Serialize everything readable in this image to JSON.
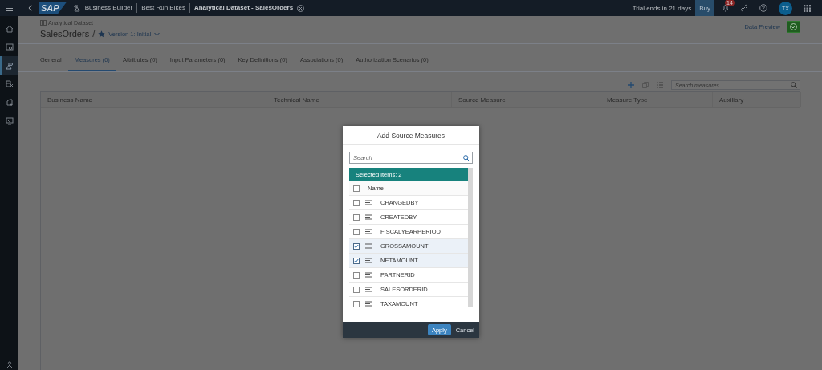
{
  "top_bar": {
    "logo": "SAP",
    "breadcrumbs": [
      "Business Builder",
      "Best Run Bikes",
      "Analytical Dataset - SalesOrders"
    ],
    "trial_text": "Trial ends in 21 days",
    "buy_button": "Buy",
    "notification_count": "14",
    "avatar": "TX"
  },
  "sidebar": {
    "items": [
      {
        "selected": false
      },
      {
        "selected": false
      },
      {
        "selected": true
      },
      {
        "selected": false
      },
      {
        "selected": false
      },
      {
        "selected": false
      }
    ]
  },
  "header": {
    "object_type": "Analytical Dataset",
    "title": "SalesOrders",
    "separator": "/",
    "version": "Version 1: Initial",
    "data_preview": "Data Preview"
  },
  "tabs": [
    {
      "label": "General",
      "selected": false
    },
    {
      "label": "Measures (0)",
      "selected": true
    },
    {
      "label": "Attributes (0)",
      "selected": false
    },
    {
      "label": "Input Parameters (0)",
      "selected": false
    },
    {
      "label": "Key Definitions (0)",
      "selected": false
    },
    {
      "label": "Associations (0)",
      "selected": false
    },
    {
      "label": "Authorization Scenarios (0)",
      "selected": false
    }
  ],
  "toolbar": {
    "search_placeholder": "Search measures"
  },
  "table": {
    "columns": [
      "Business Name",
      "Technical Name",
      "Source Measure",
      "Measure Type",
      "Auxiliary"
    ]
  },
  "dialog": {
    "title": "Add Source Measures",
    "search_placeholder": "Search",
    "selected_info": "Selected items: 2",
    "header_checked": false,
    "column_header": "Name",
    "items": [
      {
        "name": "CHANGEDBY",
        "checked": false
      },
      {
        "name": "CREATEDBY",
        "checked": false
      },
      {
        "name": "FISCALYEARPERIOD",
        "checked": false
      },
      {
        "name": "GROSSAMOUNT",
        "checked": true
      },
      {
        "name": "NETAMOUNT",
        "checked": true
      },
      {
        "name": "PARTNERID",
        "checked": false
      },
      {
        "name": "SALESORDERID",
        "checked": false
      },
      {
        "name": "TAXAMOUNT",
        "checked": false
      }
    ],
    "buttons": [
      {
        "label": "Apply",
        "kind": "primary"
      },
      {
        "label": "Cancel",
        "kind": "secondary"
      }
    ]
  }
}
